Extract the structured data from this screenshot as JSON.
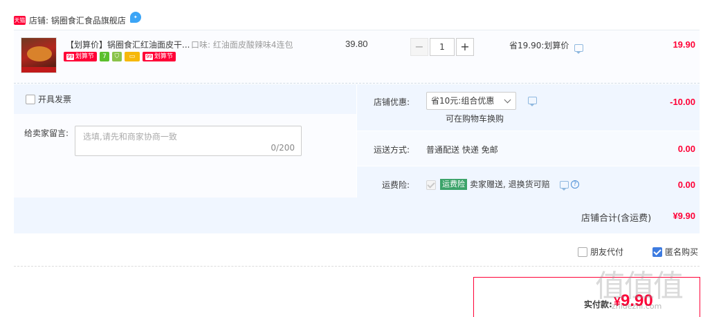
{
  "shop": {
    "badge": "天猫",
    "name": "店铺: 锅圈食汇食品旗舰店"
  },
  "item": {
    "title": "【划算价】锅圈食汇红油面皮干...",
    "spec": "口味: 红油面皮酸辣味4连包",
    "tags": [
      "划算节",
      "7",
      "划算节"
    ],
    "unit_price": "39.80",
    "quantity": "1",
    "qty_minus": "−",
    "qty_plus": "+",
    "savings": "省19.90:划算价",
    "total": "19.90"
  },
  "invoice": {
    "label": "开具发票"
  },
  "message": {
    "label": "给卖家留言:",
    "placeholder": "选填,请先和商家协商一致",
    "count": "0/200"
  },
  "discount": {
    "label": "店铺优惠:",
    "selected": "省10元:组合优惠",
    "hint": "可在购物车换购",
    "amount": "-10.00"
  },
  "shipping": {
    "label": "运送方式:",
    "value": "普通配送 快递 免邮",
    "amount": "0.00"
  },
  "insurance": {
    "label": "运费险:",
    "badge": "运费险",
    "value": "卖家赠送, 退换货可赔",
    "help": "?",
    "amount": "0.00"
  },
  "subtotal": {
    "label": "店铺合计(含运费)",
    "amount": "¥9.90"
  },
  "options": {
    "friend_pay": "朋友代付",
    "anonymous": "匿名购买"
  },
  "payment": {
    "label": "实付款:",
    "currency": "¥",
    "amount": "9.90"
  },
  "watermark": {
    "mark": "值值值",
    "site": "zhidezhi.com"
  },
  "colors": {
    "accent": "#ff0036",
    "panel": "#f0f6ff",
    "checkbox_checked": "#3d7be0"
  }
}
